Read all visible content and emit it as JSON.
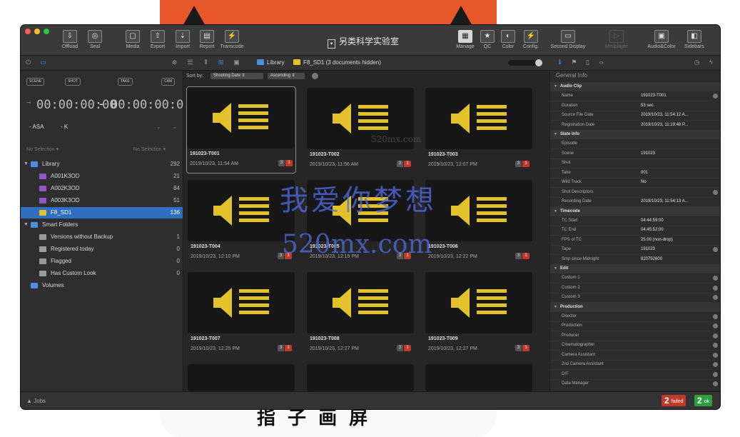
{
  "window": {
    "title": "另类科学实验室"
  },
  "background": {
    "bottom_text": "指 子 画 屏"
  },
  "toolbar": {
    "left": [
      {
        "label": "Offload",
        "icon": "offload-icon"
      },
      {
        "label": "Seal",
        "icon": "seal-icon"
      },
      {
        "label": "Media",
        "icon": "media-icon"
      },
      {
        "label": "Export",
        "icon": "export-icon"
      },
      {
        "label": "Import",
        "icon": "import-icon"
      },
      {
        "label": "Report",
        "icon": "report-icon"
      },
      {
        "label": "Transcode",
        "icon": "transcode-icon"
      }
    ],
    "right": [
      {
        "label": "Manage",
        "icon": "manage-icon"
      },
      {
        "label": "QC",
        "icon": "qc-icon"
      },
      {
        "label": "Color",
        "icon": "color-icon"
      },
      {
        "label": "Config.",
        "icon": "config-icon"
      },
      {
        "label": "Second Display",
        "icon": "second-display-icon"
      },
      {
        "label": "Miniplayer",
        "icon": "miniplayer-icon"
      },
      {
        "label": "Audio&Color",
        "icon": "audio-color-icon"
      },
      {
        "label": "Sidebars",
        "icon": "sidebars-icon"
      }
    ]
  },
  "breadcrumb": {
    "library": "Library",
    "folder": "F8_SD1 (3 documents hidden)"
  },
  "sidebar": {
    "filters": [
      "SCENE",
      "SHOT",
      "TAKE",
      "CAM"
    ],
    "timecode_in": "00:00:00:00",
    "timecode_out": "00:00:00:00",
    "asa": "ASA",
    "k": "K",
    "no_selection_left": "No Selection",
    "no_selection_right": "No Selection",
    "library": {
      "label": "Library",
      "count": "292"
    },
    "volumes_in_library": [
      {
        "label": "A001K3OD",
        "count": "21"
      },
      {
        "label": "A002K3OD",
        "count": "84"
      },
      {
        "label": "A003K3OD",
        "count": "51"
      },
      {
        "label": "F8_SD1",
        "count": "136"
      }
    ],
    "smart_folders": {
      "label": "Smart Folders"
    },
    "smart_items": [
      {
        "label": "Versions without Backup",
        "count": "1"
      },
      {
        "label": "Registered today",
        "count": "0"
      },
      {
        "label": "Flagged",
        "count": "0"
      },
      {
        "label": "Has Custom Look",
        "count": "0"
      }
    ],
    "volumes": {
      "label": "Volumes"
    }
  },
  "sort": {
    "label": "Sort by:",
    "field": "Shooting Date",
    "order": "Ascending"
  },
  "clips": [
    {
      "name": "191023-T001",
      "date": "2019/10/23, 11:54 AM",
      "badge_a": "3",
      "badge_b": "1"
    },
    {
      "name": "191023-T002",
      "date": "2019/10/23, 11:56 AM",
      "badge_a": "3",
      "badge_b": "1"
    },
    {
      "name": "191023-T003",
      "date": "2019/10/23, 12:07 PM",
      "badge_a": "3",
      "badge_b": "1"
    },
    {
      "name": "191023-T004",
      "date": "2019/10/23, 12:10 PM",
      "badge_a": "3",
      "badge_b": "1"
    },
    {
      "name": "191023-T005",
      "date": "2019/10/23, 12:19 PM",
      "badge_a": "3",
      "badge_b": "1"
    },
    {
      "name": "191023-T006",
      "date": "2019/10/23, 12:22 PM",
      "badge_a": "3",
      "badge_b": "1"
    },
    {
      "name": "191023-T007",
      "date": "2019/10/23, 12:25 PM",
      "badge_a": "3",
      "badge_b": "1"
    },
    {
      "name": "191023-T008",
      "date": "2019/10/23, 12:27 PM",
      "badge_a": "3",
      "badge_b": "1"
    },
    {
      "name": "191023-T009",
      "date": "2019/10/23, 12:27 PM",
      "badge_a": "3",
      "badge_b": "1"
    }
  ],
  "info": {
    "title": "General Info",
    "sections": [
      {
        "title": "Audio Clip",
        "fields": [
          {
            "k": "Name",
            "v": "191023-T001",
            "dot": true
          },
          {
            "k": "Duration",
            "v": "53 sec",
            "dot": false
          },
          {
            "k": "Source File Date",
            "v": "2019/10/23, 11:54:12 A...",
            "dot": false
          },
          {
            "k": "Registration Date",
            "v": "2019/10/23, 11:19:48 P...",
            "dot": false
          }
        ]
      },
      {
        "title": "Slate Info",
        "fields": [
          {
            "k": "Episode",
            "v": "",
            "dot": false
          },
          {
            "k": "Scene",
            "v": "191023",
            "dot": false
          },
          {
            "k": "Shot",
            "v": "",
            "dot": false
          },
          {
            "k": "Take",
            "v": "001",
            "dot": false
          },
          {
            "k": "Wild Track",
            "v": "No",
            "dot": false
          },
          {
            "k": "Shot Descriptors",
            "v": "",
            "dot": true
          },
          {
            "k": "Recording Date",
            "v": "2019/10/23, 11:54:13 A...",
            "dot": false
          }
        ]
      },
      {
        "title": "Timecode",
        "fields": [
          {
            "k": "TC Start",
            "v": "04:44:59:00",
            "dot": false
          },
          {
            "k": "TC End",
            "v": "04:45:52:00",
            "dot": false
          },
          {
            "k": "FPS of TC",
            "v": "25.00 (non-drop)",
            "dot": false
          },
          {
            "k": "Tape",
            "v": "191023",
            "dot": true
          },
          {
            "k": "Smp since Midnight",
            "v": "820752600",
            "dot": false
          }
        ]
      },
      {
        "title": "Edit",
        "fields": [
          {
            "k": "Custom 1",
            "v": "",
            "dot": true
          },
          {
            "k": "Custom 2",
            "v": "",
            "dot": true
          },
          {
            "k": "Custom 3",
            "v": "",
            "dot": true
          }
        ]
      },
      {
        "title": "Production",
        "fields": [
          {
            "k": "Director",
            "v": "",
            "dot": true
          },
          {
            "k": "Production",
            "v": "",
            "dot": true
          },
          {
            "k": "Producer",
            "v": "",
            "dot": true
          },
          {
            "k": "Cinematographer",
            "v": "",
            "dot": true
          },
          {
            "k": "Camera Assistant",
            "v": "",
            "dot": true
          },
          {
            "k": "2nd Camera Assistant",
            "v": "",
            "dot": true
          },
          {
            "k": "DIT",
            "v": "",
            "dot": true
          },
          {
            "k": "Data Manager",
            "v": "",
            "dot": true
          }
        ]
      }
    ]
  },
  "status": {
    "jobs": "Jobs",
    "failed_count": "2",
    "failed_label": "failed",
    "ok_count": "2",
    "ok_label": "ok"
  },
  "watermark": {
    "line1": "我爱你梦想",
    "line2": "520mx.com",
    "small": "520mx.com"
  },
  "colors": {
    "accent": "#2e6fc0",
    "speaker": "#e2c12a",
    "failed": "#c0392b",
    "ok": "#2e9e3f"
  }
}
